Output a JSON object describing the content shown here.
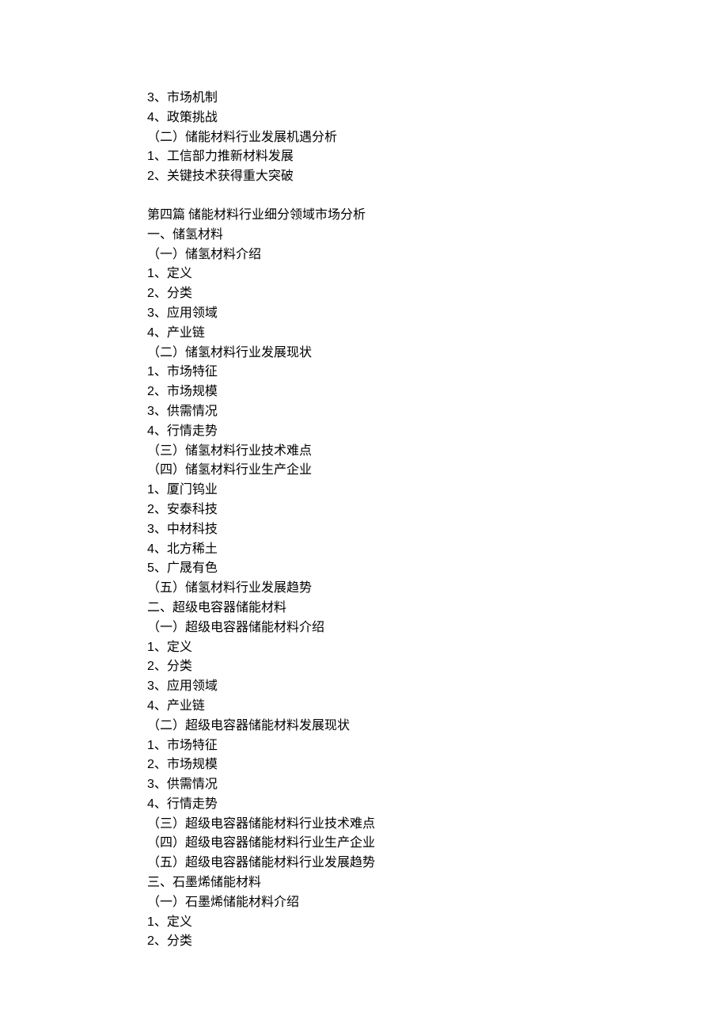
{
  "lines": [
    {
      "num": "3",
      "sep": "、",
      "text": "市场机制"
    },
    {
      "num": "4",
      "sep": "、",
      "text": "政策挑战"
    },
    {
      "text": "（二）储能材料行业发展机遇分析"
    },
    {
      "num": "1",
      "sep": "、",
      "text": "工信部力推新材料发展"
    },
    {
      "num": "2",
      "sep": "、",
      "text": "关键技术获得重大突破"
    },
    {
      "gap": true
    },
    {
      "text": "第四篇 储能材料行业细分领域市场分析"
    },
    {
      "text": "一、储氢材料"
    },
    {
      "text": "（一）储氢材料介绍"
    },
    {
      "num": "1",
      "sep": "、",
      "text": "定义"
    },
    {
      "num": "2",
      "sep": "、",
      "text": "分类"
    },
    {
      "num": "3",
      "sep": "、",
      "text": "应用领域"
    },
    {
      "num": "4",
      "sep": "、",
      "text": "产业链"
    },
    {
      "text": "（二）储氢材料行业发展现状"
    },
    {
      "num": "1",
      "sep": "、",
      "text": "市场特征"
    },
    {
      "num": "2",
      "sep": "、",
      "text": "市场规模"
    },
    {
      "num": "3",
      "sep": "、",
      "text": "供需情况"
    },
    {
      "num": "4",
      "sep": "、",
      "text": "行情走势"
    },
    {
      "text": "（三）储氢材料行业技术难点"
    },
    {
      "text": "（四）储氢材料行业生产企业"
    },
    {
      "num": "1",
      "sep": "、",
      "text": "厦门钨业"
    },
    {
      "num": "2",
      "sep": "、",
      "text": "安泰科技"
    },
    {
      "num": "3",
      "sep": "、",
      "text": "中材科技"
    },
    {
      "num": "4",
      "sep": "、",
      "text": "北方稀土"
    },
    {
      "num": "5",
      "sep": "、",
      "text": "广晟有色"
    },
    {
      "text": "（五）储氢材料行业发展趋势"
    },
    {
      "text": "二、超级电容器储能材料"
    },
    {
      "text": "（一）超级电容器储能材料介绍"
    },
    {
      "num": "1",
      "sep": "、",
      "text": "定义"
    },
    {
      "num": "2",
      "sep": "、",
      "text": "分类"
    },
    {
      "num": "3",
      "sep": "、",
      "text": "应用领域"
    },
    {
      "num": "4",
      "sep": "、",
      "text": "产业链"
    },
    {
      "text": "（二）超级电容器储能材料发展现状"
    },
    {
      "num": "1",
      "sep": "、",
      "text": "市场特征"
    },
    {
      "num": "2",
      "sep": "、",
      "text": "市场规模"
    },
    {
      "num": "3",
      "sep": "、",
      "text": "供需情况"
    },
    {
      "num": "4",
      "sep": "、",
      "text": "行情走势"
    },
    {
      "text": "（三）超级电容器储能材料行业技术难点"
    },
    {
      "text": "（四）超级电容器储能材料行业生产企业"
    },
    {
      "text": "（五）超级电容器储能材料行业发展趋势"
    },
    {
      "text": "三、石墨烯储能材料"
    },
    {
      "text": "（一）石墨烯储能材料介绍"
    },
    {
      "num": "1",
      "sep": "、",
      "text": "定义"
    },
    {
      "num": "2",
      "sep": "、",
      "text": "分类"
    }
  ]
}
